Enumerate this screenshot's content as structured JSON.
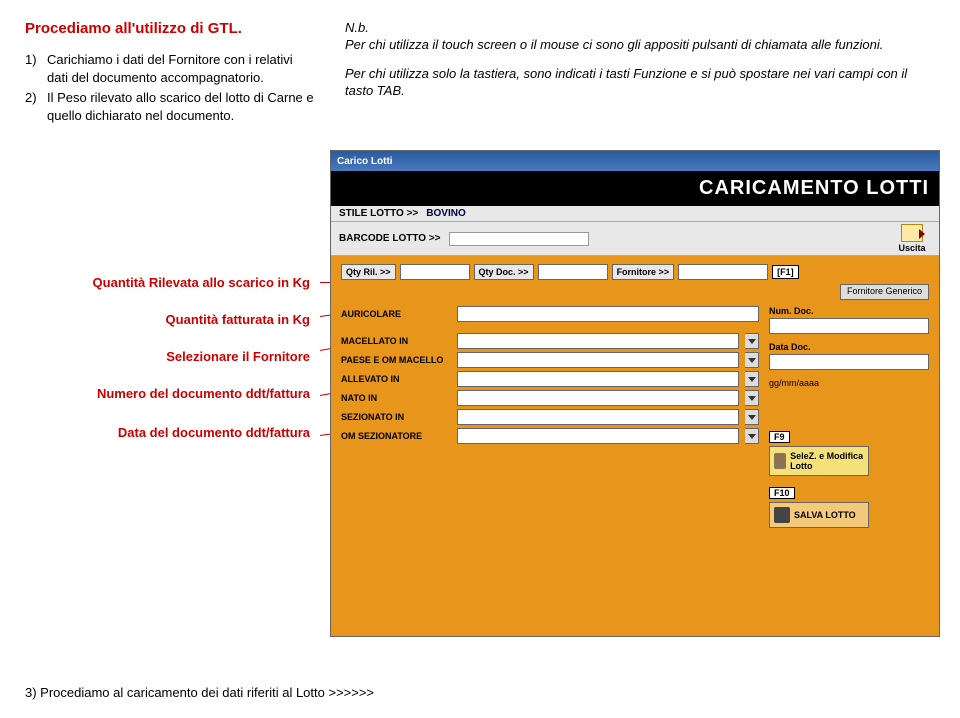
{
  "title": "Procediamo all'utilizzo di GTL.",
  "list": [
    {
      "n": "1)",
      "t": "Carichiamo i dati del Fornitore con i relativi dati del documento accompagnatorio."
    },
    {
      "n": "2)",
      "t": "Il Peso rilevato allo scarico del lotto di Carne e quello dichiarato nel documento."
    }
  ],
  "nb": {
    "head": "N.b.",
    "p1": "Per chi utilizza il touch screen o il mouse ci sono gli appositi pulsanti di chiamata alle funzioni.",
    "p2": "Per chi utilizza solo la tastiera, sono indicati i tasti Funzione e si può spostare nei vari campi con il tasto TAB."
  },
  "annots": {
    "a1": "Quantità Rilevata allo scarico in Kg",
    "a2": "Quantità fatturata in Kg",
    "a3": "Selezionare il Fornitore",
    "a4": "Numero del documento ddt/fattura",
    "a5": "Data del documento ddt/fattura"
  },
  "app": {
    "titlebar": "Carico Lotti",
    "header_title": "CARICAMENTO LOTTI",
    "strip1": {
      "label": "STILE LOTTO >>",
      "value": "BOVINO"
    },
    "strip2": {
      "label": "BARCODE LOTTO >>"
    },
    "uscita": "Uscita",
    "toprow": {
      "qty_ril": "Qty Ril. >>",
      "qty_doc": "Qty Doc. >>",
      "fornitore": "Fornitore >>",
      "f1": "[F1]"
    },
    "gen_btn": "Fornitore Generico",
    "fields": {
      "auricolare": "AURICOLARE",
      "macellato": "MACELLATO IN",
      "paese_om": "PAESE E OM MACELLO",
      "allevato": "ALLEVATO IN",
      "nato": "NATO IN",
      "sezionato": "SEZIONATO IN",
      "om_sez": "OM SEZIONATORE"
    },
    "right": {
      "numdoc": "Num. Doc.",
      "datadoc": "Data Doc.",
      "datefmt": "gg/mm/aaaa",
      "f9": "F9",
      "b1": "SeleZ. e Modifica Lotto",
      "f10": "F10",
      "b2": "SALVA LOTTO"
    }
  },
  "bottom": "3)   Procediamo al caricamento dei dati riferiti al Lotto >>>>>>"
}
